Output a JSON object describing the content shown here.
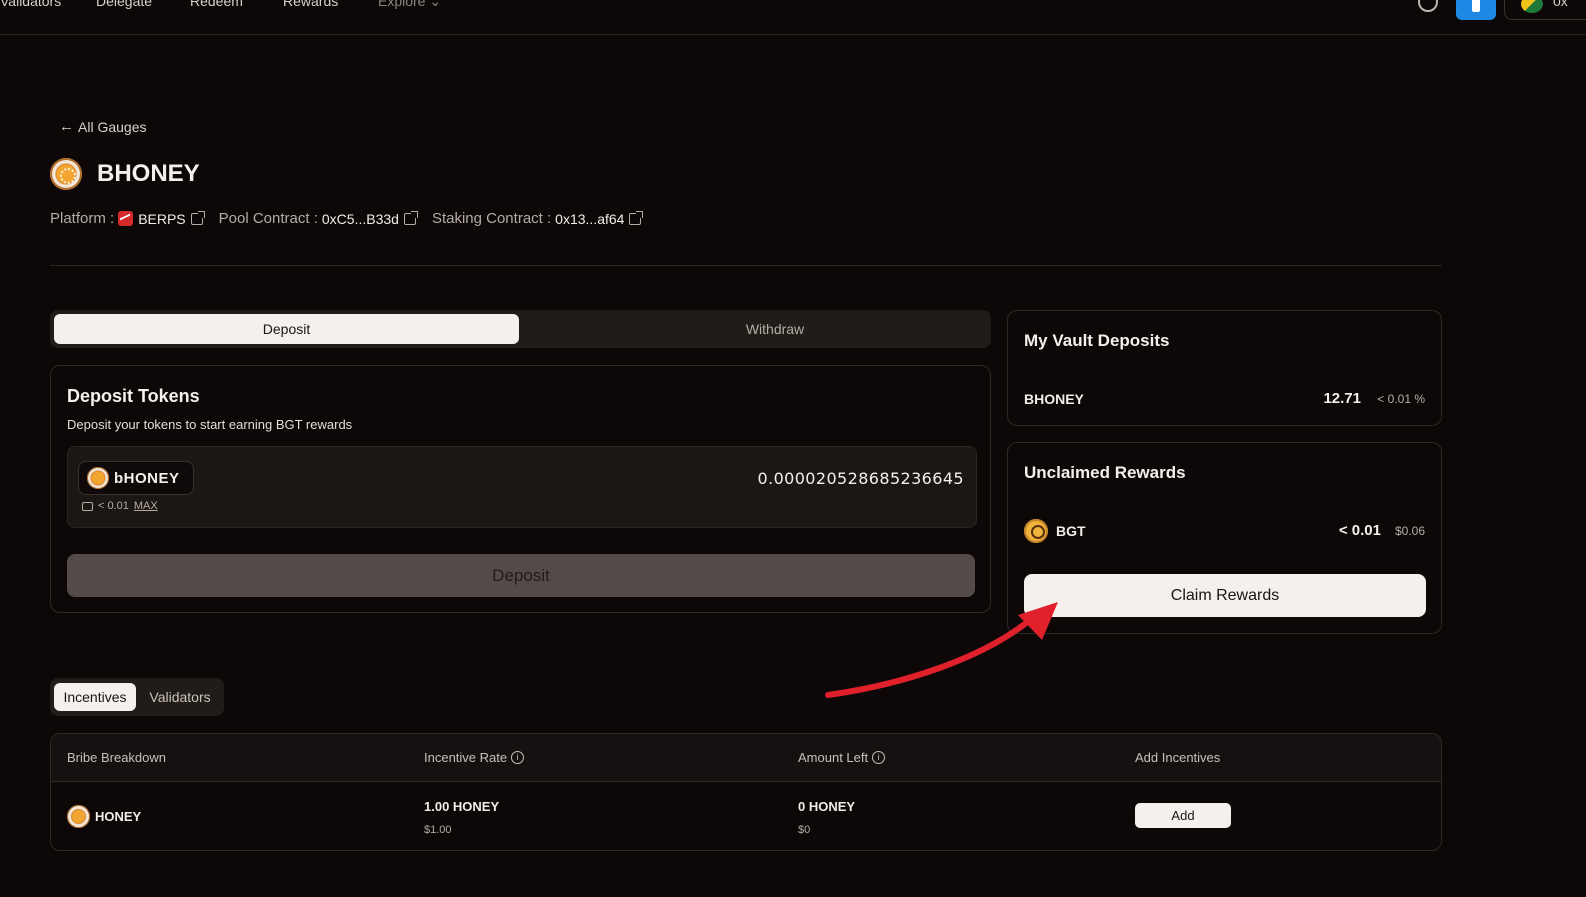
{
  "nav": {
    "items": [
      "Validators",
      "Delegate",
      "Redeem",
      "Rewards"
    ],
    "explore_label": "Explore",
    "wallet_text": "0x"
  },
  "back_link": "All Gauges",
  "title": "BHONEY",
  "meta": {
    "platform_label": "Platform :",
    "platform_value": "BERPS",
    "pool_label": "Pool Contract :",
    "pool_value": "0xC5...B33d",
    "staking_label": "Staking Contract :",
    "staking_value": "0x13...af64"
  },
  "tabs": {
    "active": "Deposit",
    "inactive": "Withdraw"
  },
  "deposit_card": {
    "title": "Deposit Tokens",
    "subtitle": "Deposit your tokens to start earning BGT rewards",
    "token_name": "bHONEY",
    "balance": "< 0.01",
    "max_label": "MAX",
    "amount": "0.000020528685236645",
    "button_label": "Deposit"
  },
  "vault_card": {
    "title": "My Vault Deposits",
    "token": "BHONEY",
    "amount": "12.71",
    "percent": "< 0.01 %"
  },
  "rewards_card": {
    "title": "Unclaimed Rewards",
    "token": "BGT",
    "amount": "< 0.01",
    "usd": "$0.06",
    "button_label": "Claim Rewards"
  },
  "subtabs": {
    "active": "Incentives",
    "inactive": "Validators"
  },
  "table": {
    "headers": [
      "Bribe Breakdown",
      "Incentive Rate",
      "Amount Left",
      "Add Incentives"
    ],
    "row": {
      "token": "HONEY",
      "rate": "1.00 HONEY",
      "rate_usd": "$1.00",
      "left": "0 HONEY",
      "left_usd": "$0",
      "action": "Add"
    }
  },
  "colors": {
    "background": "#0d0807",
    "accent_light": "#f4f1ec",
    "annotation_arrow": "#e0202a"
  }
}
